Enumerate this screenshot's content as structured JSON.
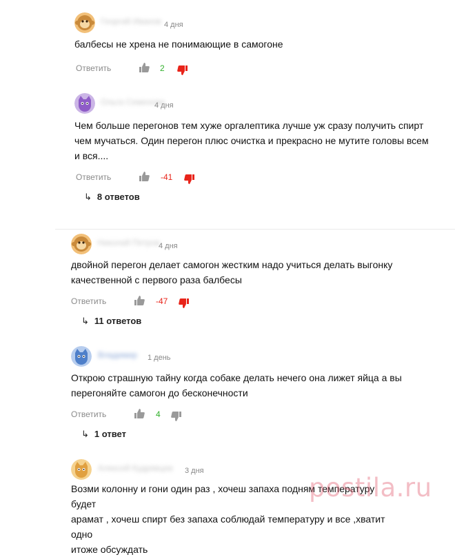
{
  "colors": {
    "positive": "#31b02b",
    "negative": "#e8241a",
    "muted": "#8a8a8a",
    "watermark": "#e15a6e"
  },
  "comments": [
    {
      "name": "Георгий Иванов",
      "time": "4 дня",
      "text": [
        "балбесы не хрена не понимающие в самогоне"
      ],
      "reply": "Ответить",
      "score": "2",
      "score_type": "positive",
      "avatar": "monkey-icon"
    },
    {
      "name": "Ольга Семенова",
      "time": "4 дня",
      "text": [
        "Чем больше перегонов тем хуже оргалептика лучше уж сразу получить спирт",
        "чем мучаться. Один перегон плюс очистка и прекрасно не мутите головы всем",
        "и вся...."
      ],
      "reply": "Ответить",
      "score": "-41",
      "score_type": "negative",
      "avatar": "purple-cat-icon",
      "answers": "8 ответов"
    },
    {
      "name": "Николай Петров",
      "time": "4 дня",
      "text": [
        "двойной перегон делает самогон жестким надо учиться делать выгонку",
        "качественной с первого раза балбесы"
      ],
      "reply": "Ответить",
      "score": "-47",
      "score_type": "negative",
      "avatar": "monkey-icon",
      "answers": "11 ответов"
    },
    {
      "name": "Владимир",
      "time": "1 день",
      "text": [
        "Открою страшную тайну когда собаке делать нечего она лижет яйца а вы",
        "перегоняйте самогон до бесконечности"
      ],
      "reply": "Ответить",
      "score": "4",
      "score_type": "positive",
      "avatar": "blue-cat-icon",
      "answers": "1 ответ"
    },
    {
      "name": "Алексей Кудрявцев",
      "time": "3 дня",
      "text": [
        "Возми колонну и гони один раз , хочеш запаха подням температуру будет",
        "арамат , хочеш спирт без запаха соблюдай температуру и все ,хватит одно",
        "итоже обсуждать"
      ],
      "avatar": "orange-cat-icon"
    }
  ],
  "watermark": "postila.ru"
}
